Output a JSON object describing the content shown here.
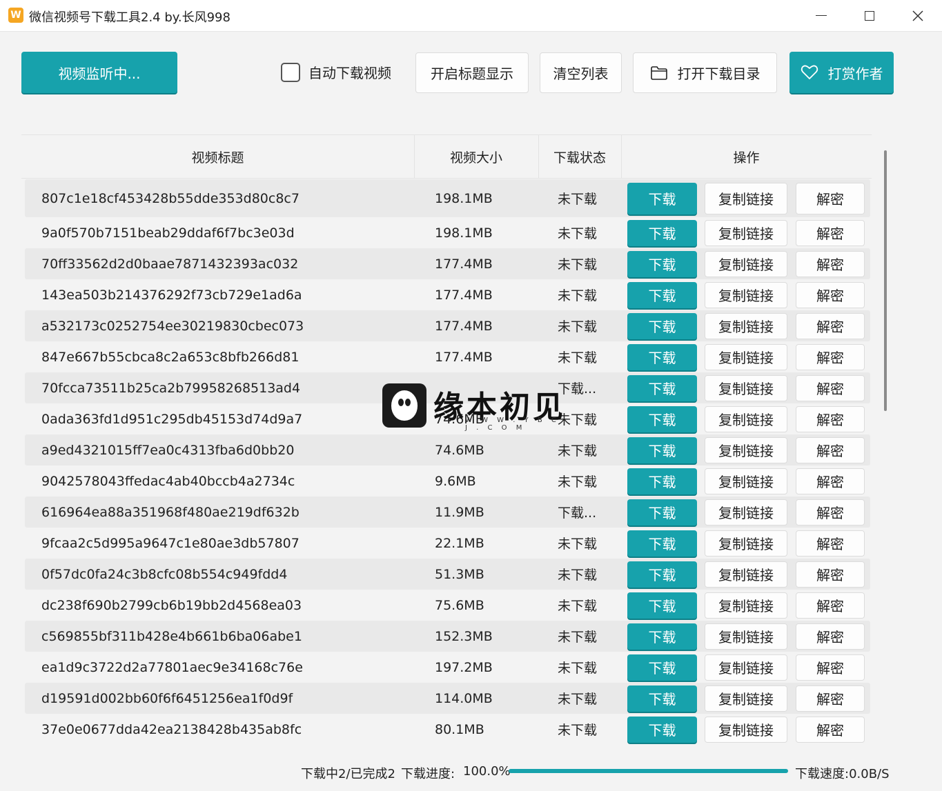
{
  "window": {
    "title": "微信视频号下载工具2.4 by.长风998",
    "app_icon_glyph": "W",
    "accent_color": "#17a2ac"
  },
  "toolbar": {
    "monitor_label": "视频监听中...",
    "auto_download_label": "自动下载视频",
    "auto_download_checked": false,
    "show_title_label": "开启标题显示",
    "clear_list_label": "清空列表",
    "open_dir_label": "打开下载目录",
    "reward_label": "打赏作者"
  },
  "table": {
    "headers": {
      "title": "视频标题",
      "size": "视频大小",
      "status": "下载状态",
      "ops": "操作"
    },
    "buttons": {
      "download": "下载",
      "copy_link": "复制链接",
      "decrypt": "解密"
    },
    "rows": [
      {
        "title": "807c1e18cf453428b55dde353d80c8c7",
        "size": "198.1MB",
        "status": "未下载"
      },
      {
        "title": "9a0f570b7151beab29ddaf6f7bc3e03d",
        "size": "198.1MB",
        "status": "未下载"
      },
      {
        "title": "70ff33562d2d0baae7871432393ac032",
        "size": "177.4MB",
        "status": "未下载"
      },
      {
        "title": "143ea503b214376292f73cb729e1ad6a",
        "size": "177.4MB",
        "status": "未下载"
      },
      {
        "title": "a532173c0252754ee30219830cbec073",
        "size": "177.4MB",
        "status": "未下载"
      },
      {
        "title": "847e667b55cbca8c2a653c8bfb266d81",
        "size": "177.4MB",
        "status": "未下载"
      },
      {
        "title": "70fcca73511b25ca2b79958268513ad4",
        "size": "",
        "status": "下载..."
      },
      {
        "title": "0ada363fd1d951c295db45153d74d9a7",
        "size": "74.6MB",
        "status": "未下载"
      },
      {
        "title": "a9ed4321015ff7ea0c4313fba6d0bb20",
        "size": "74.6MB",
        "status": "未下载"
      },
      {
        "title": "9042578043ffedac4ab40bccb4a2734c",
        "size": "9.6MB",
        "status": "未下载"
      },
      {
        "title": "616964ea88a351968f480ae219df632b",
        "size": "11.9MB",
        "status": "下载..."
      },
      {
        "title": "9fcaa2c5d995a9647c1e80ae3db57807",
        "size": "22.1MB",
        "status": "未下载"
      },
      {
        "title": "0f57dc0fa24c3b8cfc08b554c949fdd4",
        "size": "51.3MB",
        "status": "未下载"
      },
      {
        "title": "dc238f690b2799cb6b19bb2d4568ea03",
        "size": "75.6MB",
        "status": "未下载"
      },
      {
        "title": "c569855bf311b428e4b661b6ba06abe1",
        "size": "152.3MB",
        "status": "未下载"
      },
      {
        "title": "ea1d9c3722d2a77801aec9e34168c76e",
        "size": "197.2MB",
        "status": "未下载"
      },
      {
        "title": "d19591d002bb60f6f6451256ea1f0d9f",
        "size": "114.0MB",
        "status": "未下载"
      },
      {
        "title": "37e0e0677dda42ea2138428b435ab8fc",
        "size": "80.1MB",
        "status": "未下载"
      }
    ]
  },
  "watermark": {
    "text": "缘本初见",
    "sub": "W W W . Y B C J . C O M"
  },
  "footer": {
    "count_text": "下载中2/已完成2",
    "progress_label": "下载进度:",
    "progress_value": "100.0%",
    "progress_fraction": 1.0,
    "speed_text": "下载速度:0.0B/S"
  }
}
